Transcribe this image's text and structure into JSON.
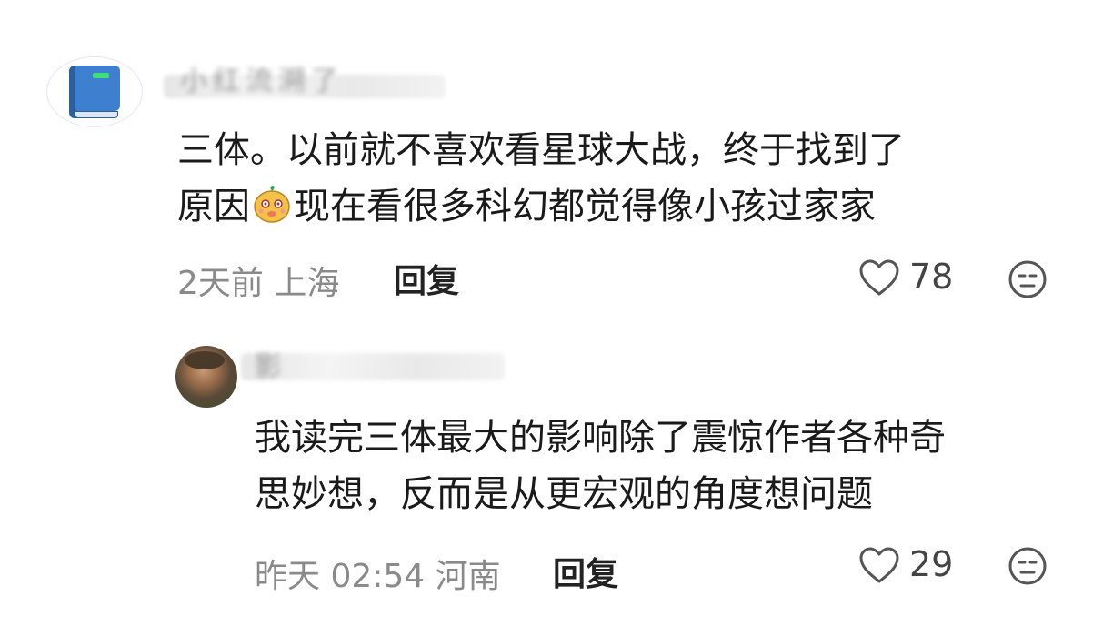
{
  "comments": [
    {
      "username": "小红流溯了",
      "content_line1": "三体。以前就不喜欢看星球大战，终于找到了",
      "content_line2_a": "原因",
      "content_line2_b": "现在看很多科幻都觉得像小孩过家家",
      "meta": "2天前 上海",
      "reply_label": "回复",
      "likes": "78",
      "icons": [
        "book-avatar",
        "emoji-sticker",
        "heart-icon",
        "dislike-face-icon"
      ]
    },
    {
      "username": "影",
      "content_line1": "我读完三体最大的影响除了震惊作者各种奇",
      "content_line2": "思妙想，反而是从更宏观的角度想问题",
      "meta": "昨天 02:54 河南",
      "reply_label": "回复",
      "likes": "29",
      "icons": [
        "photo-avatar",
        "heart-icon",
        "dislike-face-icon"
      ]
    }
  ]
}
